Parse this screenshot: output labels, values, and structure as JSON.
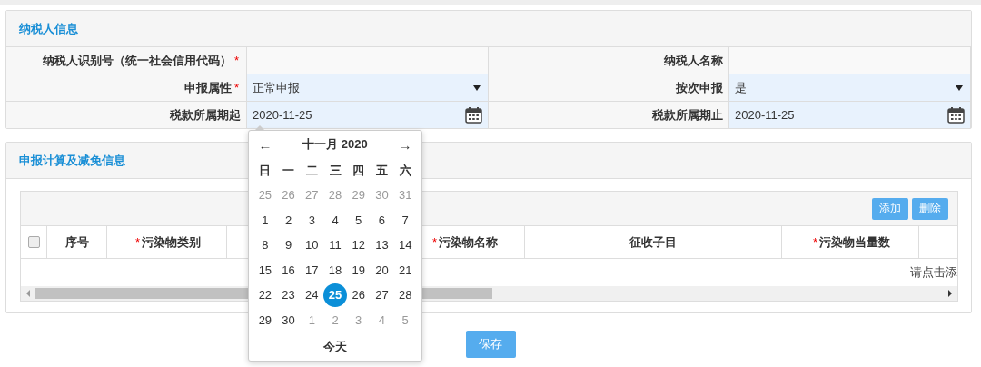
{
  "taxpayer_panel": {
    "title": "纳税人信息",
    "fields": [
      {
        "label": "纳税人识别号（统一社会信用代码）",
        "required_mark": "*",
        "kind": "text"
      },
      {
        "label": "纳税人名称",
        "kind": "text"
      },
      {
        "label": "申报属性",
        "required_mark": "*",
        "kind": "select",
        "value": "正常申报"
      },
      {
        "label": "按次申报",
        "kind": "select",
        "value": "是"
      },
      {
        "label": "税款所属期起",
        "kind": "date",
        "value": "2020-11-25"
      },
      {
        "label": "税款所属期止",
        "kind": "date",
        "value": "2020-11-25"
      }
    ]
  },
  "calc_panel": {
    "title": "申报计算及减免信息",
    "buttons": [
      "添加",
      "删除"
    ],
    "columns": [
      {
        "kind": "check",
        "checked": false
      },
      {
        "kind": "label",
        "label": "序号"
      },
      {
        "kind": "label",
        "label": "污染物类别",
        "required_mark": "*"
      },
      {
        "kind": "blank"
      },
      {
        "kind": "label",
        "label": "污染物名称",
        "required_mark": "*"
      },
      {
        "kind": "label",
        "label": "征收子目"
      },
      {
        "kind": "label",
        "label": "污染物当量数",
        "required_mark": "*"
      },
      {
        "kind": "blank"
      }
    ],
    "empty_text": "请点击添"
  },
  "datepicker": {
    "prev": "←",
    "next": "→",
    "title": "十一月 2020",
    "weekdays": [
      "日",
      "一",
      "二",
      "三",
      "四",
      "五",
      "六"
    ],
    "weeks": [
      [
        {
          "d": "25",
          "other": true,
          "selected": false
        },
        {
          "d": "26",
          "other": true,
          "selected": false
        },
        {
          "d": "27",
          "other": true,
          "selected": false
        },
        {
          "d": "28",
          "other": true,
          "selected": false
        },
        {
          "d": "29",
          "other": true,
          "selected": false
        },
        {
          "d": "30",
          "other": true,
          "selected": false
        },
        {
          "d": "31",
          "other": true,
          "selected": false
        }
      ],
      [
        {
          "d": "1",
          "other": false,
          "selected": false
        },
        {
          "d": "2",
          "other": false,
          "selected": false
        },
        {
          "d": "3",
          "other": false,
          "selected": false
        },
        {
          "d": "4",
          "other": false,
          "selected": false
        },
        {
          "d": "5",
          "other": false,
          "selected": false
        },
        {
          "d": "6",
          "other": false,
          "selected": false
        },
        {
          "d": "7",
          "other": false,
          "selected": false
        }
      ],
      [
        {
          "d": "8",
          "other": false,
          "selected": false
        },
        {
          "d": "9",
          "other": false,
          "selected": false
        },
        {
          "d": "10",
          "other": false,
          "selected": false
        },
        {
          "d": "11",
          "other": false,
          "selected": false
        },
        {
          "d": "12",
          "other": false,
          "selected": false
        },
        {
          "d": "13",
          "other": false,
          "selected": false
        },
        {
          "d": "14",
          "other": false,
          "selected": false
        }
      ],
      [
        {
          "d": "15",
          "other": false,
          "selected": false
        },
        {
          "d": "16",
          "other": false,
          "selected": false
        },
        {
          "d": "17",
          "other": false,
          "selected": false
        },
        {
          "d": "18",
          "other": false,
          "selected": false
        },
        {
          "d": "19",
          "other": false,
          "selected": false
        },
        {
          "d": "20",
          "other": false,
          "selected": false
        },
        {
          "d": "21",
          "other": false,
          "selected": false
        }
      ],
      [
        {
          "d": "22",
          "other": false,
          "selected": false
        },
        {
          "d": "23",
          "other": false,
          "selected": false
        },
        {
          "d": "24",
          "other": false,
          "selected": false
        },
        {
          "d": "25",
          "other": false,
          "selected": true
        },
        {
          "d": "26",
          "other": false,
          "selected": false
        },
        {
          "d": "27",
          "other": false,
          "selected": false
        },
        {
          "d": "28",
          "other": false,
          "selected": false
        }
      ],
      [
        {
          "d": "29",
          "other": false,
          "selected": false
        },
        {
          "d": "30",
          "other": false,
          "selected": false
        },
        {
          "d": "1",
          "other": true,
          "selected": false
        },
        {
          "d": "2",
          "other": true,
          "selected": false
        },
        {
          "d": "3",
          "other": true,
          "selected": false
        },
        {
          "d": "4",
          "other": true,
          "selected": false
        },
        {
          "d": "5",
          "other": true,
          "selected": false
        }
      ]
    ],
    "today": "今天"
  },
  "save_button": "保存"
}
